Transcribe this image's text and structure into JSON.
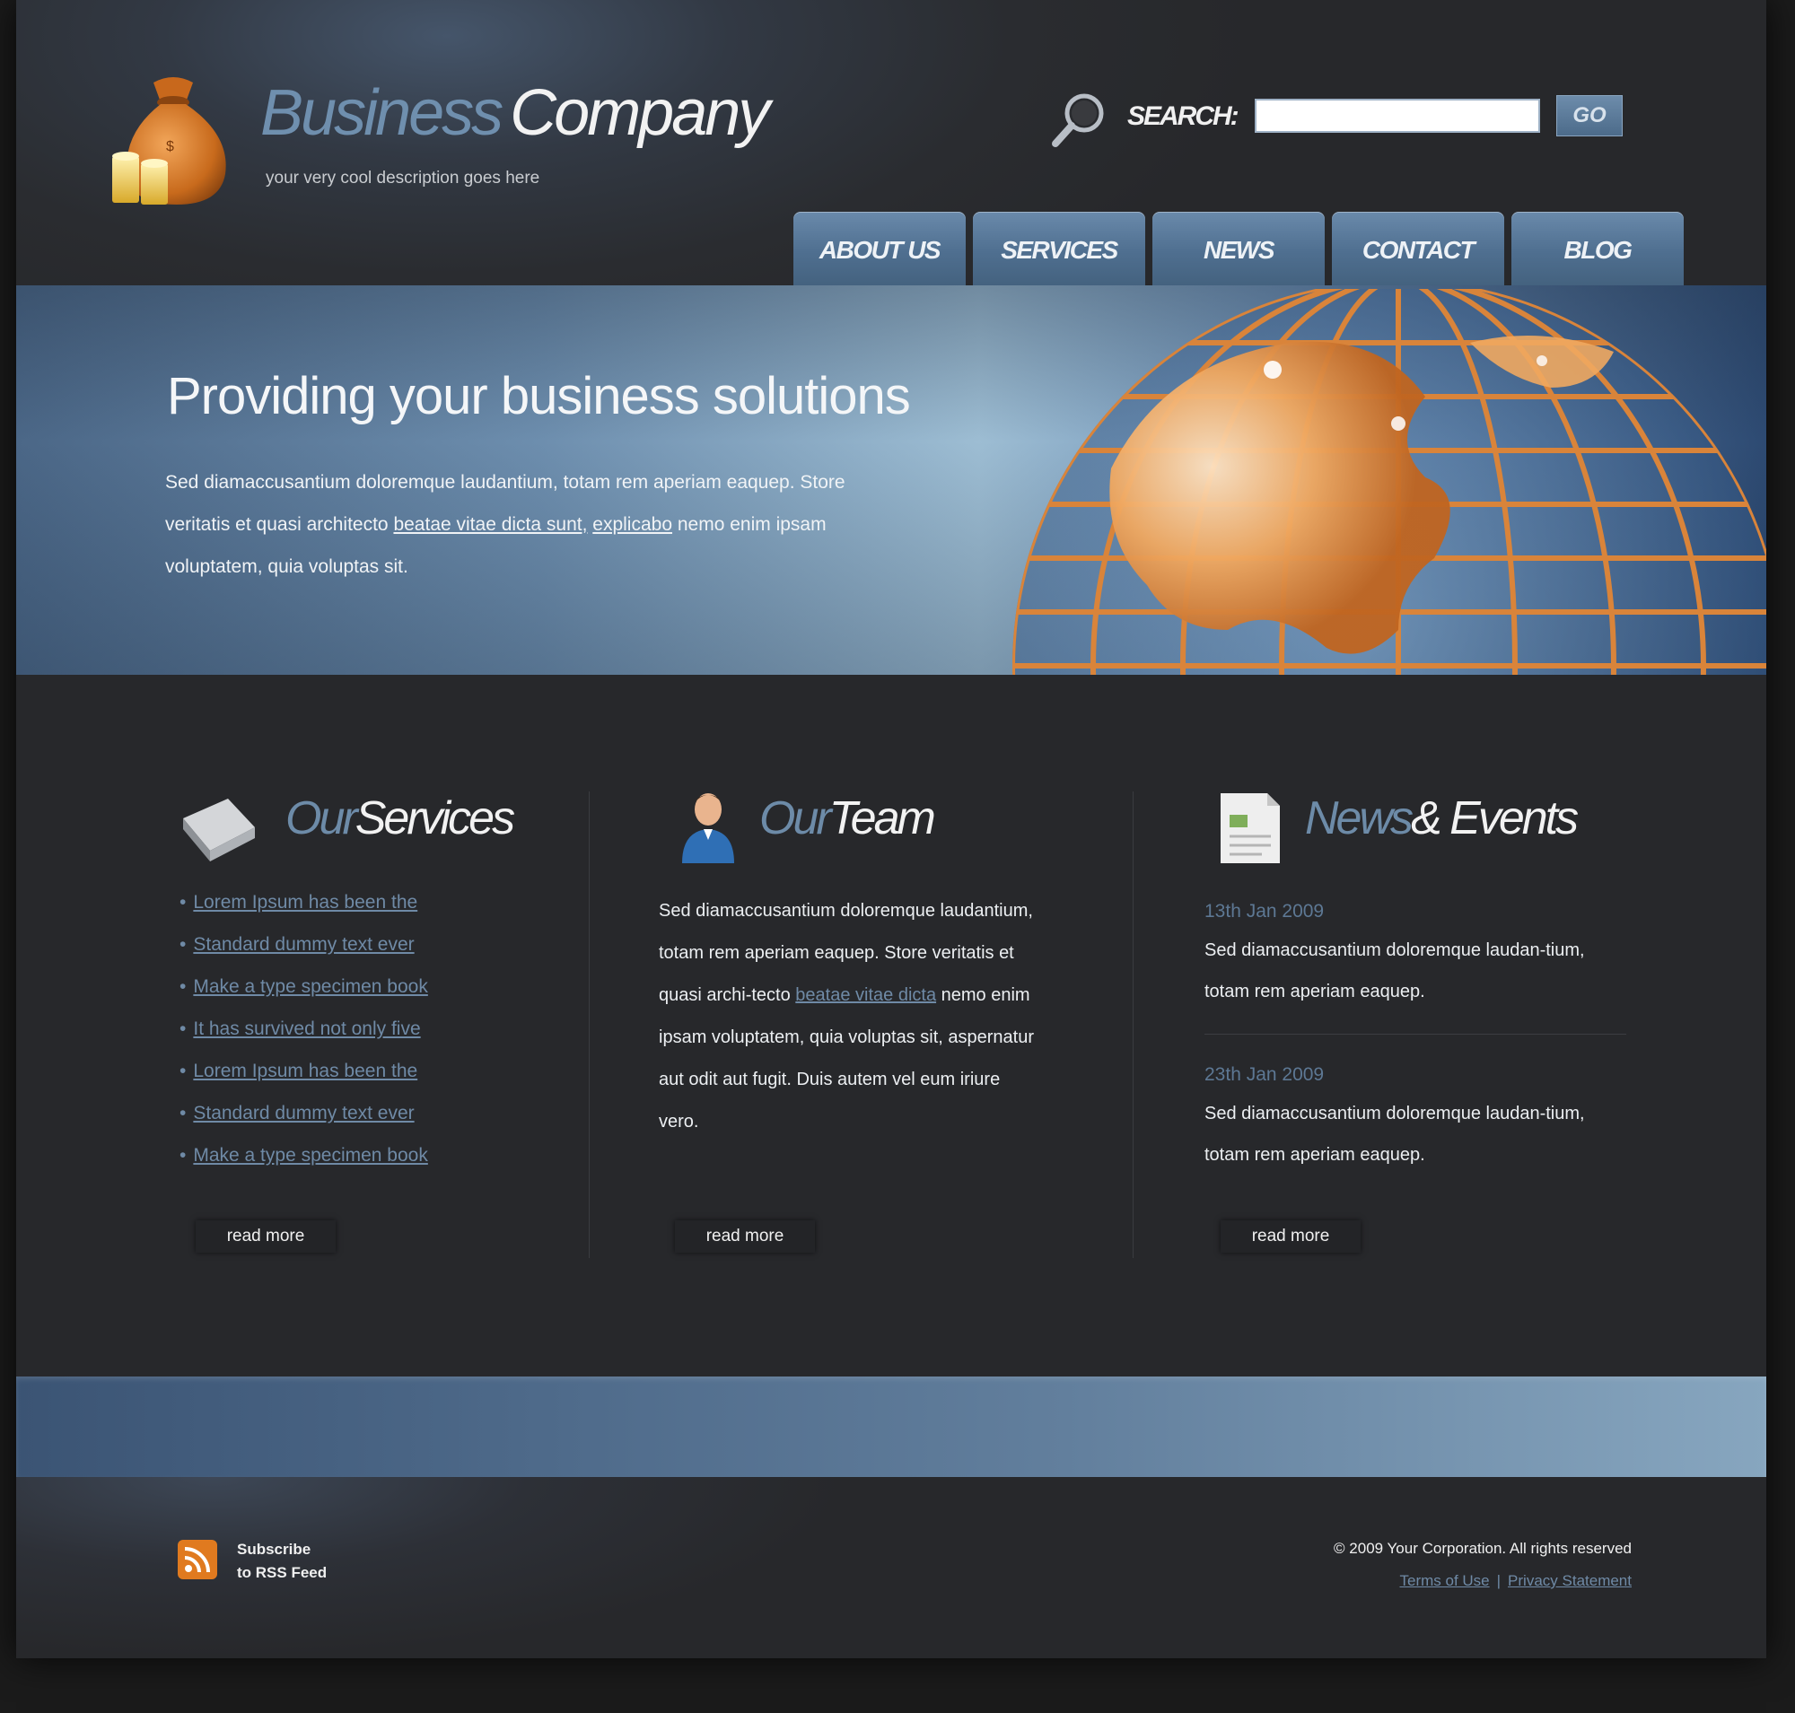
{
  "header": {
    "brand_part1": "Business",
    "brand_part2": "Company",
    "tagline": "your very cool description goes here",
    "search_label": "SEARCH:",
    "search_value": "",
    "go_label": "GO"
  },
  "nav": {
    "tabs": [
      {
        "label": "ABOUT US"
      },
      {
        "label": "SERVICES"
      },
      {
        "label": "NEWS"
      },
      {
        "label": "CONTACT"
      },
      {
        "label": "BLOG"
      }
    ]
  },
  "hero": {
    "title": "Providing your business solutions",
    "text_part1": "Sed diamaccusantium doloremque laudantium, totam rem aperiam eaquep. Store veritatis et quasi architecto ",
    "link1": "beatae vitae dicta sunt,",
    "text_part2": " ",
    "link2": "explicabo",
    "text_part3": " nemo enim ipsam voluptatem, quia voluptas sit."
  },
  "services": {
    "heading_part1": "Our",
    "heading_part2": "Services",
    "items": [
      "Lorem Ipsum has been the",
      "Standard dummy text ever",
      "Make a type specimen book",
      "It has survived not only five",
      "Lorem Ipsum has been the",
      "Standard dummy text ever",
      "Make a type specimen book"
    ],
    "read_more": "read more"
  },
  "team": {
    "heading_part1": "Our",
    "heading_part2": "Team",
    "text_part1": "Sed diamaccusantium doloremque laudantium, totam rem aperiam eaquep. Store veritatis et quasi archi-tecto ",
    "link": "beatae vitae dicta",
    "text_part2": " nemo enim ipsam voluptatem, quia voluptas sit, aspernatur aut odit aut fugit. Duis autem vel eum iriure vero.",
    "read_more": "read more"
  },
  "news": {
    "heading_part1": "News",
    "heading_part2": "& Events",
    "items": [
      {
        "date": "13th Jan 2009",
        "text": "Sed diamaccusantium doloremque laudan-tium, totam rem aperiam eaquep."
      },
      {
        "date": "23th Jan 2009",
        "text": "Sed diamaccusantium doloremque laudan-tium, totam rem aperiam eaquep."
      }
    ],
    "read_more": "read more"
  },
  "footer": {
    "rss_line1": "Subscribe",
    "rss_line2": "to RSS Feed",
    "copyright": "© 2009 Your Corporation. All rights reserved",
    "terms": "Terms of Use",
    "separator": "|",
    "privacy": "Privacy Statement"
  },
  "colors": {
    "accent_blue": "#6f8aa6",
    "nav_blue": "#557594",
    "dark_bg": "#27282b",
    "orange": "#e07a1f"
  },
  "icons": {
    "logo": "money-bag-icon",
    "search": "magnifier-icon",
    "services": "book-icon",
    "team": "person-icon",
    "news": "document-icon",
    "rss": "rss-icon"
  }
}
